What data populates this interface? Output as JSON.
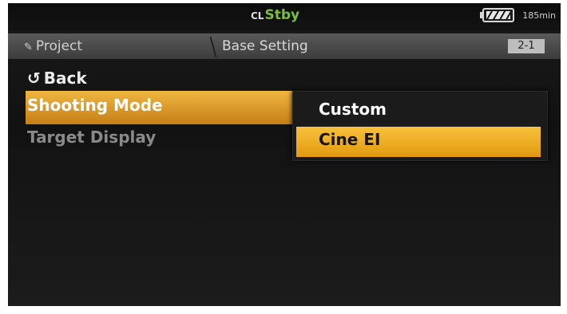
{
  "status": {
    "mode_prefix": "CL",
    "mode": "Stby",
    "battery_label": "185min"
  },
  "header": {
    "project_label": "Project",
    "section_label": "Base Setting",
    "page_label": "2-1"
  },
  "menu": {
    "back_label": "Back",
    "items": [
      {
        "label": "Shooting Mode",
        "selected": true
      },
      {
        "label": "Target Display",
        "selected": false
      }
    ]
  },
  "popup": {
    "options": [
      {
        "label": "Custom",
        "selected": false
      },
      {
        "label": "Cine EI",
        "selected": true
      }
    ]
  },
  "colors": {
    "highlight": "#f0b640",
    "mode_green": "#7bbf3a"
  }
}
